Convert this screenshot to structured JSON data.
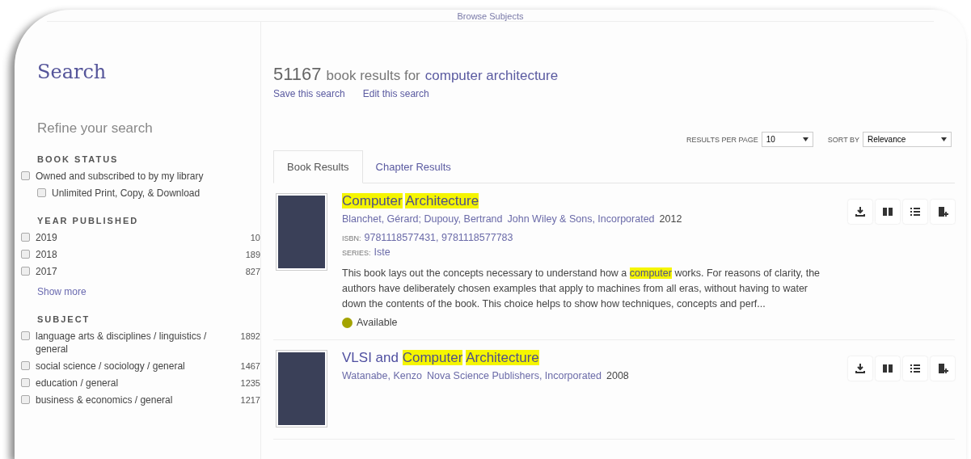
{
  "top_link": "Browse Subjects",
  "sidebar": {
    "title": "Search",
    "subtitle": "Refine your search",
    "sections": [
      {
        "heading": "BOOK STATUS",
        "items": [
          {
            "label": "Owned and subscribed to by my library",
            "checked": false,
            "children": [
              {
                "label": "Unlimited Print, Copy, & Download",
                "checked": false
              }
            ]
          }
        ]
      },
      {
        "heading": "YEAR PUBLISHED",
        "items": [
          {
            "label": "2019",
            "count": "10",
            "checked": false
          },
          {
            "label": "2018",
            "count": "189",
            "checked": false
          },
          {
            "label": "2017",
            "count": "827",
            "checked": false
          }
        ],
        "more": "Show more"
      },
      {
        "heading": "SUBJECT",
        "items": [
          {
            "label": "language arts & disciplines / linguistics / general",
            "count": "1892",
            "checked": false
          },
          {
            "label": "social science / sociology / general",
            "count": "1467",
            "checked": false
          },
          {
            "label": "education / general",
            "count": "1235",
            "checked": false
          },
          {
            "label": "business & economics / general",
            "count": "1217",
            "checked": false
          }
        ]
      }
    ]
  },
  "results": {
    "count": "51167",
    "summary": "book results for",
    "query": "computer architecture",
    "links": [
      "Save this search",
      "Edit this search"
    ],
    "per_page": {
      "label": "RESULTS PER PAGE",
      "value": "10"
    },
    "sort": {
      "label": "SORT BY",
      "value": "Relevance"
    },
    "tabs": [
      {
        "label": "Book Results",
        "selected": true
      },
      {
        "label": "Chapter Results",
        "selected": false
      }
    ],
    "books": [
      {
        "title": [
          {
            "text": "Computer",
            "highlight": true
          },
          {
            "text": "Architecture",
            "highlight": true
          }
        ],
        "authors": "Blanchet, Gérard; Dupouy, Bertrand",
        "publisher": "John Wiley & Sons, Incorporated",
        "year": "2012",
        "isbn_label": "ISBN:",
        "isbn": "9781118577431, 9781118577783",
        "series_label": "SERIES:",
        "series": "Iste",
        "description": [
          {
            "text": "This book lays out the concepts necessary to understand how a",
            "highlight": false
          },
          {
            "text": "computer",
            "highlight": true
          },
          {
            "text": "works. For reasons of clarity, the authors have deliberately chosen examples that apply to machines from all eras, without having to water down the contents of the book. This choice helps to show how techniques, concepts and perf...",
            "highlight": false
          }
        ],
        "status": {
          "label": "Available",
          "color": "#a3a300"
        }
      },
      {
        "title": [
          {
            "text": "VLSI and",
            "highlight": false
          },
          {
            "text": "Computer",
            "highlight": true
          },
          {
            "text": "Architecture",
            "highlight": true
          }
        ],
        "authors": "Watanabe, Kenzo",
        "publisher": "Nova Science Publishers, Incorporated",
        "year": "2008"
      }
    ]
  }
}
